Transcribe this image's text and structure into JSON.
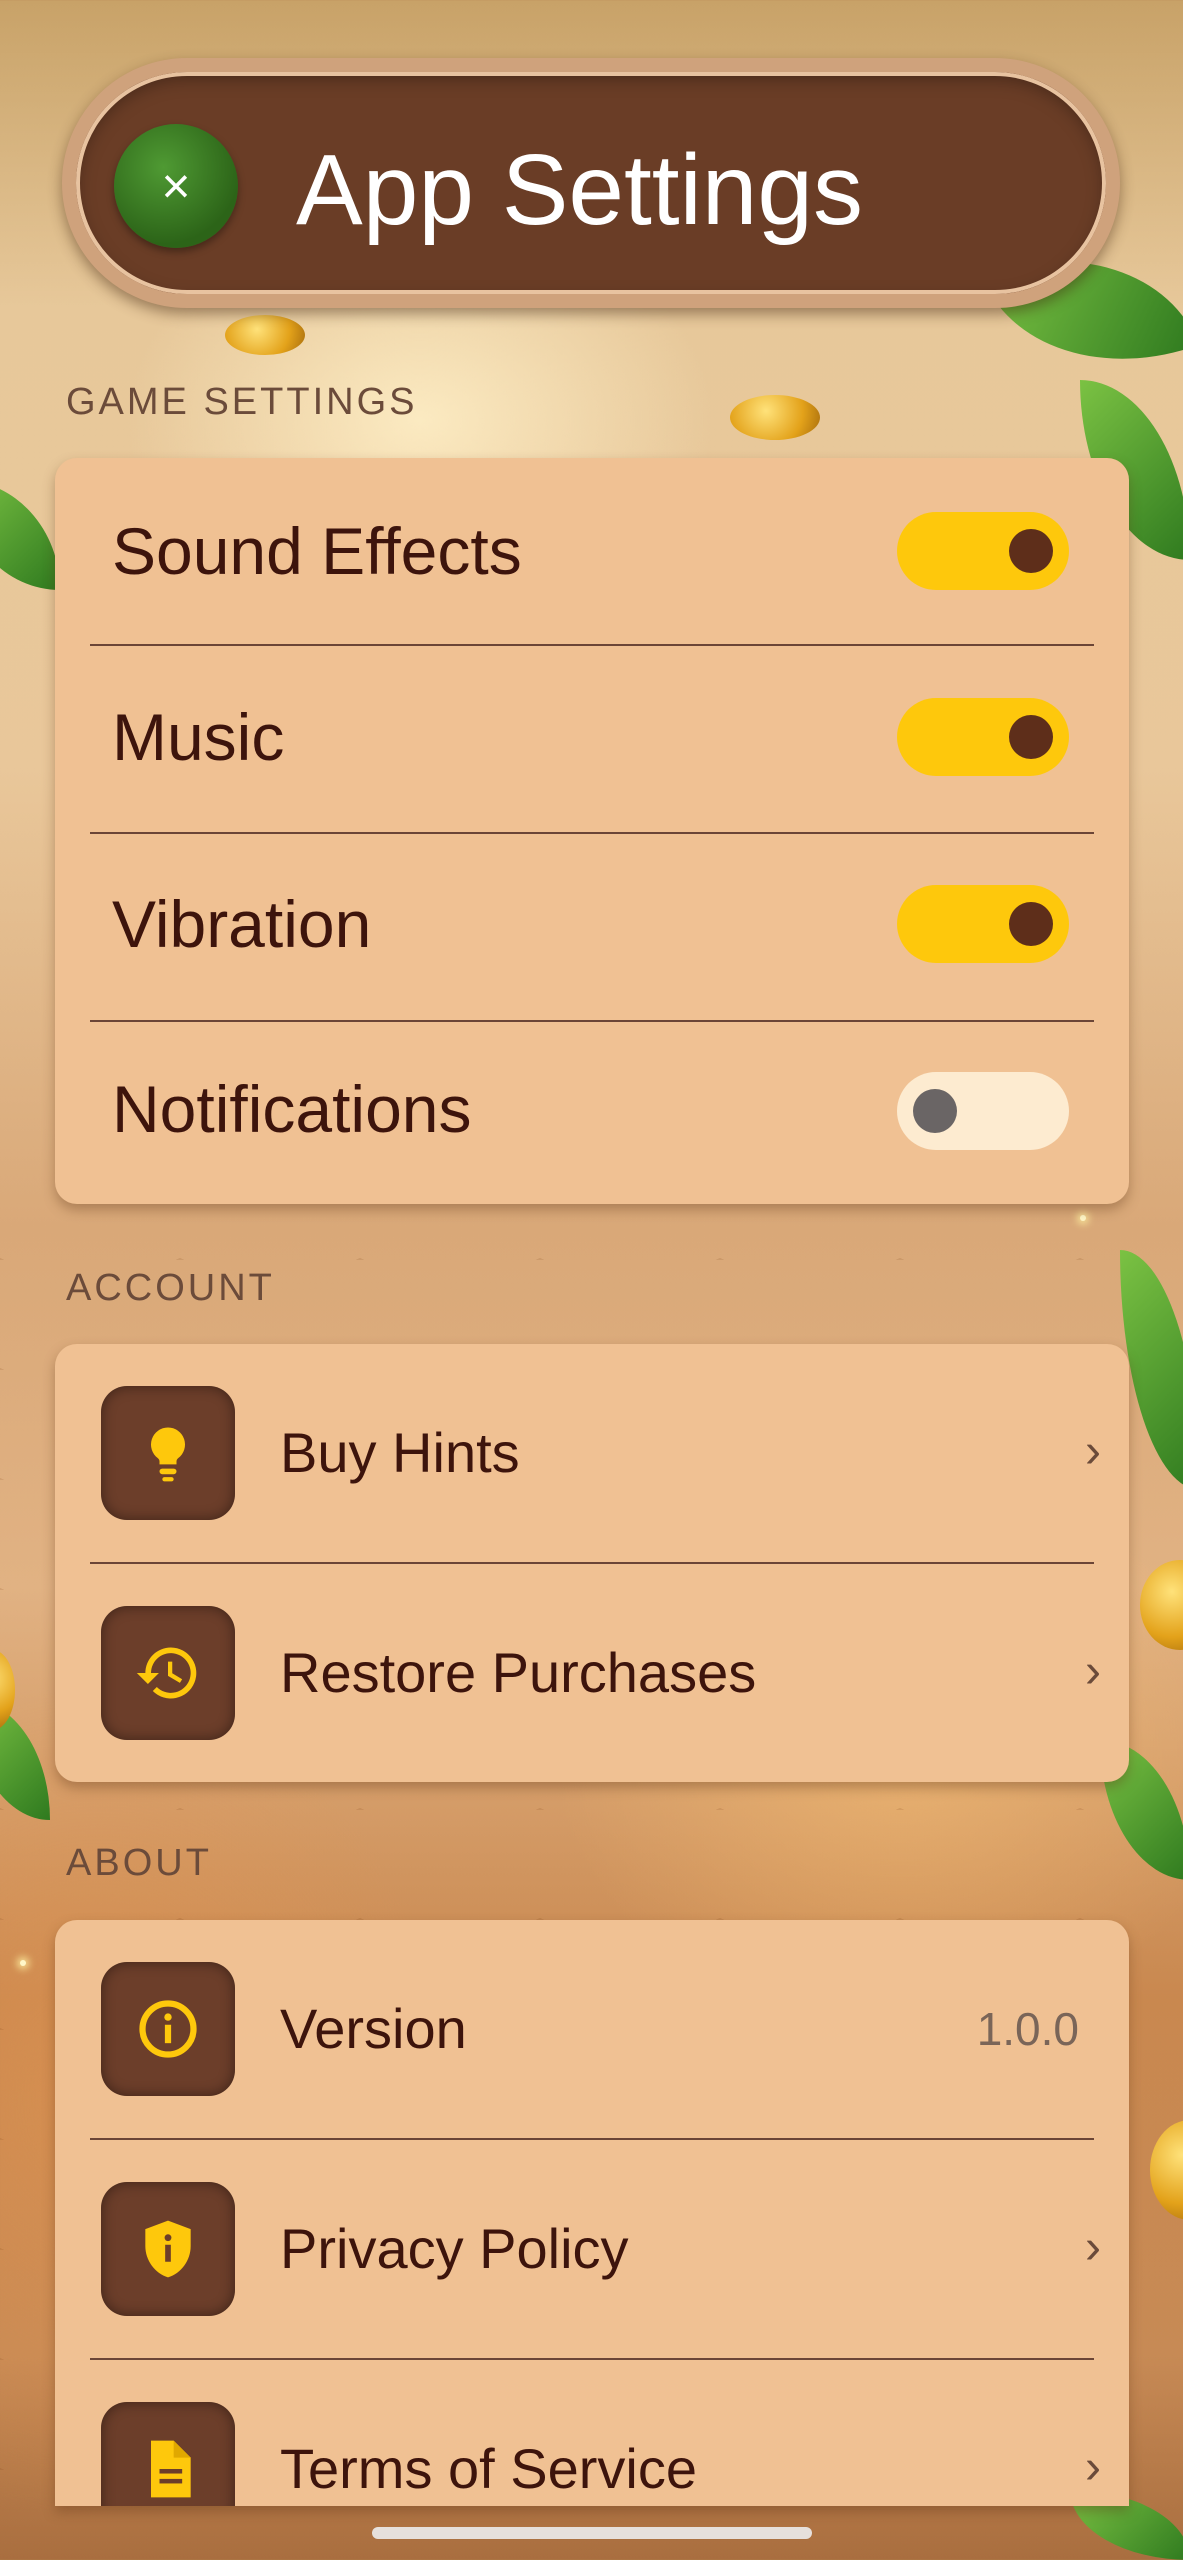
{
  "header": {
    "title": "App Settings",
    "close_icon": "×"
  },
  "sections": {
    "game_settings": {
      "label": "GAME SETTINGS",
      "toggles": [
        {
          "label": "Sound Effects",
          "on": true
        },
        {
          "label": "Music",
          "on": true
        },
        {
          "label": "Vibration",
          "on": true
        },
        {
          "label": "Notifications",
          "on": false
        }
      ]
    },
    "account": {
      "label": "ACCOUNT",
      "items": [
        {
          "label": "Buy Hints",
          "icon": "lightbulb-icon",
          "chevron": "›"
        },
        {
          "label": "Restore Purchases",
          "icon": "restore-icon",
          "chevron": "›"
        }
      ]
    },
    "about": {
      "label": "ABOUT",
      "items": [
        {
          "label": "Version",
          "icon": "info-icon",
          "value": "1.0.0"
        },
        {
          "label": "Privacy Policy",
          "icon": "shield-icon",
          "chevron": "›"
        },
        {
          "label": "Terms of Service",
          "icon": "document-icon",
          "chevron": "›"
        }
      ]
    }
  },
  "colors": {
    "accent_yellow": "#fec80c",
    "card_bg": "#f0c193",
    "header_bg": "#6a3d26",
    "text_dark": "#3d140c",
    "close_green": "#3a7a22"
  }
}
